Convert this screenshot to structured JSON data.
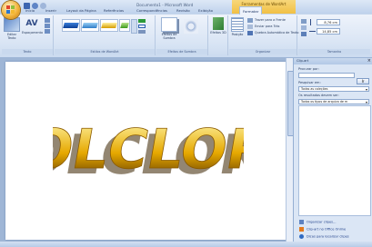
{
  "window": {
    "title": "Documento1 - Microsoft Word",
    "context_tools_label": "Ferramentas de WordArt"
  },
  "tabs": [
    {
      "label": "Início"
    },
    {
      "label": "Inserir"
    },
    {
      "label": "Layout da Página"
    },
    {
      "label": "Referências"
    },
    {
      "label": "Correspondências"
    },
    {
      "label": "Revisão"
    },
    {
      "label": "Exibição"
    },
    {
      "label": "Formatar",
      "active": true
    }
  ],
  "ribbon": {
    "texto": {
      "group_label": "Texto",
      "edit_text": "Editar Texto",
      "spacing": "Espaçamento"
    },
    "styles": {
      "group_label": "Estilos de WordArt"
    },
    "shadow": {
      "group_label": "Efeitos de Sombra",
      "button": "Efeitos de Sombra"
    },
    "effects3d": {
      "button": "Efeitos 3D"
    },
    "arrange": {
      "group_label": "Organizar",
      "position": "Posição",
      "bring_front": "Trazer para a Frente",
      "send_back": "Enviar para Trás",
      "text_wrap": "Quebra Automática de Texto"
    },
    "size": {
      "group_label": "Tamanho",
      "height": "8,76 cm",
      "width": "14,85 cm"
    }
  },
  "document": {
    "wordart_text": "FOLCLORE"
  },
  "pane": {
    "title": "Clip-art",
    "search_for_label": "Procurar por:",
    "search_in_label": "Pesquisar em:",
    "search_in_value": "Todas as coleções",
    "results_label": "Os resultados devem ser:",
    "results_value": "Todos os tipos de arquivo de m",
    "go_label": "Ir",
    "links": [
      {
        "label": "Organizar clipes..."
      },
      {
        "label": "Clip-art no Office Online"
      },
      {
        "label": "Dicas para localizar clipes"
      }
    ]
  },
  "colors": {
    "wordart_top": "#fff6a8",
    "wordart_mid": "#e6a800",
    "wordart_bottom": "#5a3500"
  }
}
